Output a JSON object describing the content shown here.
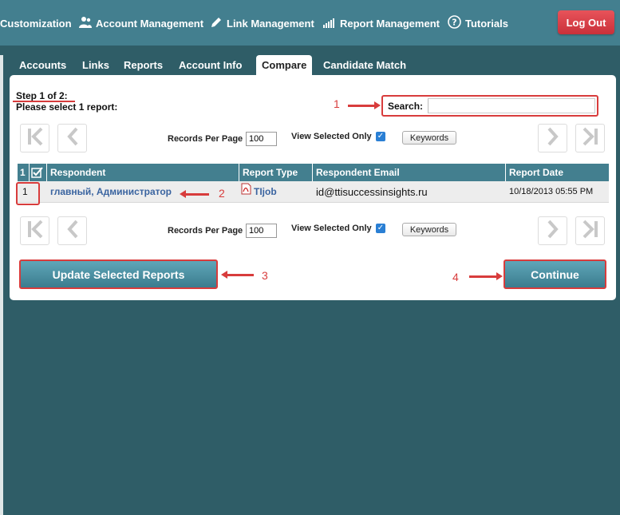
{
  "nav": {
    "customization": "Customization",
    "account_management": "Account Management",
    "link_management": "Link Management",
    "report_management": "Report Management",
    "tutorials": "Tutorials",
    "logout": "Log Out"
  },
  "tabs": [
    "Accounts",
    "Links",
    "Reports",
    "Account Info",
    "Compare",
    "Candidate Match"
  ],
  "active_tab": "Compare",
  "step": {
    "line1": "Step 1 of 2:",
    "line2": "Please select 1 report:"
  },
  "search": {
    "label": "Search:",
    "value": ""
  },
  "pager": {
    "records_per_page_label": "Records Per Page",
    "records_per_page_value": "100",
    "view_selected_label": "View Selected Only",
    "view_selected_checked": true,
    "keywords_label": "Keywords"
  },
  "table": {
    "headers": {
      "count": "1",
      "respondent": "Respondent",
      "report_type": "Report Type",
      "respondent_email": "Respondent Email",
      "report_date": "Report Date"
    },
    "rows": [
      {
        "index": "1",
        "respondent": "главный, Администратор",
        "report_type": "TIjob",
        "email": "id@ttisuccessinsights.ru",
        "date": "10/18/2013 05:55 PM"
      }
    ]
  },
  "buttons": {
    "update": "Update Selected Reports",
    "continue": "Continue"
  },
  "annotations": {
    "n1": "1",
    "n2": "2",
    "n3": "3",
    "n4": "4"
  },
  "colors": {
    "header_bar": "#437f8f",
    "background": "#2f5d67",
    "annotation_red": "#d83c3c",
    "logout_red": "#d9434b",
    "link_blue": "#3a64a0"
  }
}
